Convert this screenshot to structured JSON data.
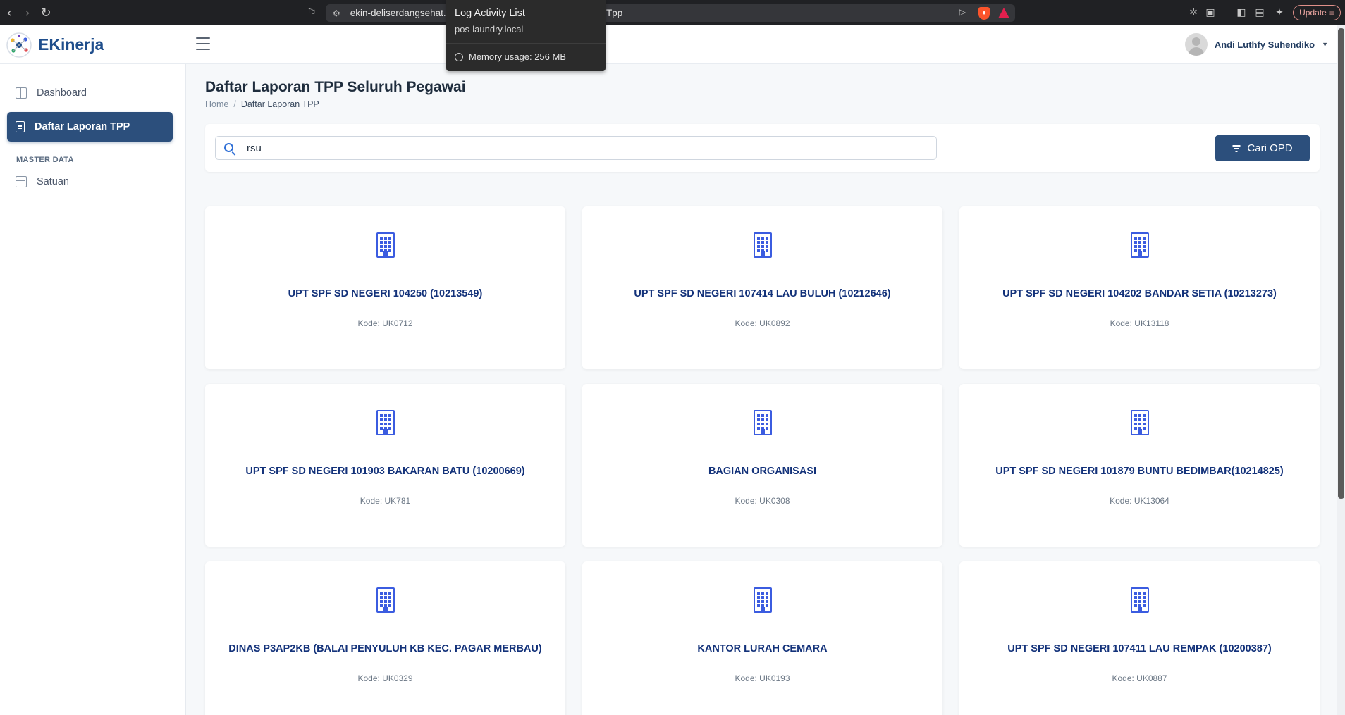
{
  "browser": {
    "url_left": "ekin-deliserdangsehat.d",
    "url_right": "Tpp",
    "update_label": "Update"
  },
  "tooltip": {
    "title": "Log Activity List",
    "host": "pos-laundry.local",
    "memory": "Memory usage: 256 MB"
  },
  "header": {
    "brand": "EKinerja",
    "user_name": "Andi Luthfy Suhendiko"
  },
  "sidebar": {
    "items": [
      {
        "label": "Dashboard"
      },
      {
        "label": "Daftar Laporan TPP"
      }
    ],
    "section_label": "MASTER DATA",
    "master_items": [
      {
        "label": "Satuan"
      }
    ]
  },
  "page": {
    "title": "Daftar Laporan TPP Seluruh Pegawai",
    "breadcrumb": {
      "home": "Home",
      "separator": "/",
      "current": "Daftar Laporan TPP"
    }
  },
  "search": {
    "value": "rsu",
    "button_label": "Cari OPD"
  },
  "cards": [
    {
      "title": "UPT SPF SD NEGERI 104250 (10213549)",
      "code": "Kode: UK0712"
    },
    {
      "title": "UPT SPF SD NEGERI 107414 LAU BULUH (10212646)",
      "code": "Kode: UK0892"
    },
    {
      "title": "UPT SPF SD NEGERI 104202 BANDAR SETIA (10213273)",
      "code": "Kode: UK13118"
    },
    {
      "title": "UPT SPF SD NEGERI 101903 BAKARAN BATU (10200669)",
      "code": "Kode: UK781"
    },
    {
      "title": "BAGIAN ORGANISASI",
      "code": "Kode: UK0308"
    },
    {
      "title": "UPT SPF SD NEGERI 101879 BUNTU BEDIMBAR(10214825)",
      "code": "Kode: UK13064"
    },
    {
      "title": "DINAS P3AP2KB (BALAI PENYULUH KB KEC. PAGAR MERBAU)",
      "code": "Kode: UK0329"
    },
    {
      "title": "KANTOR LURAH CEMARA",
      "code": "Kode: UK0193"
    },
    {
      "title": "UPT SPF SD NEGERI 107411 LAU REMPAK (10200387)",
      "code": "Kode: UK0887"
    }
  ],
  "colors": {
    "primary": "#2c4f7c",
    "icon_blue": "#3b5ce0",
    "card_title": "#13327a"
  }
}
